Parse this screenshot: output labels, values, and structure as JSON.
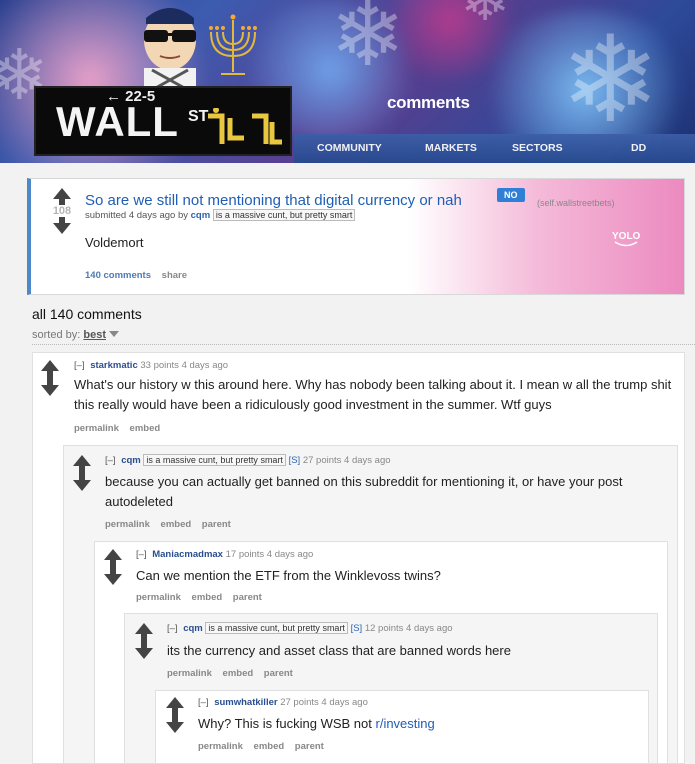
{
  "header": {
    "subreddit_title": "comments",
    "logo_wall": "WALL",
    "logo_arrow": "← 22-5",
    "logo_st": "ST",
    "tabs": [
      "COMMUNITY",
      "MARKETS",
      "SECTORS",
      "DD"
    ]
  },
  "post": {
    "score": "108",
    "title": "So are we still not mentioning that digital currency or nah",
    "link_flair": "NO",
    "domain": "(self.wallstreetbets)",
    "submitted_prefix": "submitted",
    "time_ago": "4 days ago",
    "by_label": "by",
    "author": "cqm",
    "author_flair": "is a massive cunt, but pretty smart",
    "body": "Voldemort",
    "comments_link": "140 comments",
    "share_link": "share",
    "yolo_text": "YOLO"
  },
  "comment_area": {
    "heading": "all 140 comments",
    "sorted_by_label": "sorted by:",
    "sort_value": "best"
  },
  "comments": [
    {
      "collapse": "[–]",
      "author": "starkmatic",
      "flair": "",
      "submitter_tag": "",
      "meta": "33 points 4 days ago",
      "text": "What's our history w this around here. Why has nobody been talking about it. I mean w all the trump shit this really would have been a ridiculously good investment in the summer. Wtf guys",
      "buttons": [
        "permalink",
        "embed"
      ]
    },
    {
      "collapse": "[–]",
      "author": "cqm",
      "flair": "is a massive cunt, but pretty smart",
      "submitter_tag": "[S]",
      "meta": "27 points 4 days ago",
      "text": "because you can actually get banned on this subreddit for mentioning it, or have your post autodeleted",
      "buttons": [
        "permalink",
        "embed",
        "parent"
      ]
    },
    {
      "collapse": "[–]",
      "author": "Maniacmadmax",
      "flair": "",
      "submitter_tag": "",
      "meta": "17 points 4 days ago",
      "text": "Can we mention the ETF from the Winklevoss twins?",
      "buttons": [
        "permalink",
        "embed",
        "parent"
      ]
    },
    {
      "collapse": "[–]",
      "author": "cqm",
      "flair": "is a massive cunt, but pretty smart",
      "submitter_tag": "[S]",
      "meta": "12 points 4 days ago",
      "text": "its the currency and asset class that are banned words here",
      "buttons": [
        "permalink",
        "embed",
        "parent"
      ]
    },
    {
      "collapse": "[–]",
      "author": "sumwhatkiller",
      "flair": "",
      "submitter_tag": "",
      "meta": "27 points 4 days ago",
      "text": "Why? This is fucking WSB not ",
      "link": "r/investing",
      "buttons": [
        "permalink",
        "embed",
        "parent"
      ]
    }
  ]
}
